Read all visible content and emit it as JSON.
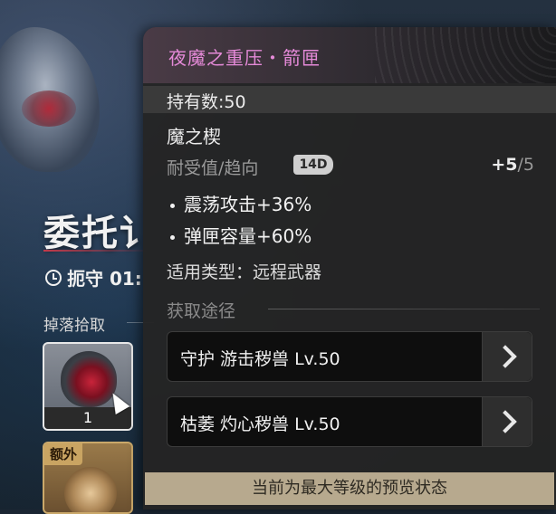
{
  "background": {
    "title": "委托讠",
    "timer_text": "扼守 01:",
    "drop_label": "掉落拾取",
    "items": [
      {
        "count": "1"
      },
      {
        "badge": "额外"
      }
    ]
  },
  "tooltip": {
    "title": "夜魔之重压・箭匣",
    "owned": "持有数:50",
    "name": "魔之楔",
    "durability_label": "耐受值/趋向",
    "durability_badge": "14D",
    "durability_current": "+5",
    "durability_max": "/5",
    "stats": [
      "震荡攻击+36%",
      "弹匣容量+60%"
    ],
    "weapon_type": "适用类型：远程武器",
    "source_label": "获取途径",
    "sources": [
      {
        "label": "守护 游击秽兽 Lv.50"
      },
      {
        "label": "枯萎 灼心秽兽 Lv.50"
      }
    ],
    "footer": "当前为最大等级的预览状态"
  },
  "colors": {
    "title_accent": "#e58ad8",
    "footer_bg": "#b7a98e",
    "panel_bg": "#242424"
  },
  "icons": {
    "timer": "clock-icon",
    "source_arrow": "chevron-right-icon",
    "cursor": "mouse-cursor-icon"
  }
}
